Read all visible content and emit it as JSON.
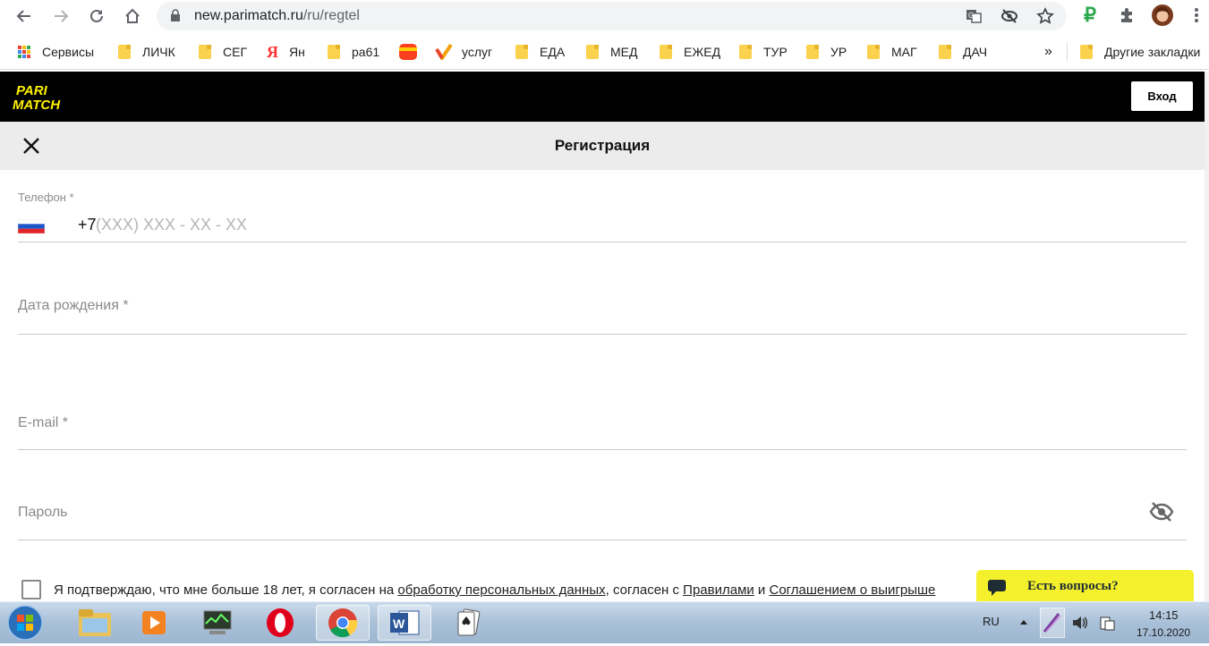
{
  "browser": {
    "url_host": "new.parimatch.ru",
    "url_path": "/ru/regtel"
  },
  "bookmarks": {
    "items": [
      {
        "label": "Сервисы",
        "icon": "apps-grid-icon"
      },
      {
        "label": "ЛИЧК",
        "icon": "folder-icon"
      },
      {
        "label": "СЕГ",
        "icon": "folder-icon"
      },
      {
        "label": "Ян",
        "icon": "yandex-icon"
      },
      {
        "label": "ра61",
        "icon": "folder-icon"
      },
      {
        "label": "",
        "icon": "service-icon"
      },
      {
        "label": "услуг",
        "icon": "gosuslugi-icon"
      },
      {
        "label": "ЕДА",
        "icon": "folder-icon"
      },
      {
        "label": "МЕД",
        "icon": "folder-icon"
      },
      {
        "label": "ЕЖЕД",
        "icon": "folder-icon"
      },
      {
        "label": "ТУР",
        "icon": "folder-icon"
      },
      {
        "label": "УР",
        "icon": "folder-icon"
      },
      {
        "label": "МАГ",
        "icon": "folder-icon"
      },
      {
        "label": "ДАЧ",
        "icon": "folder-icon"
      }
    ],
    "overflow": "»",
    "other_label": "Другие закладки"
  },
  "header": {
    "logo_line1": "PARI",
    "logo_line2": "MATCH",
    "login_label": "Вход",
    "brand_color": "#fff200"
  },
  "registration": {
    "title": "Регистрация",
    "phone_label": "Телефон *",
    "phone_prefix": "+7",
    "phone_placeholder": "(XXX) XXX - XX - XX",
    "birth_label": "Дата рождения *",
    "email_label": "E-mail *",
    "password_label": "Пароль",
    "consent_text_1": "Я подтверждаю, что мне больше 18 лет, я согласен на ",
    "consent_link_1": "обработку персональных данных",
    "consent_text_2": ", согласен с ",
    "consent_link_2": "Правилами",
    "consent_text_3": " и ",
    "consent_link_3": "Соглашением о выигрыше"
  },
  "chat": {
    "label": "Есть вопросы?"
  },
  "taskbar": {
    "language": "RU",
    "time": "14:15",
    "date": "17.10.2020"
  }
}
